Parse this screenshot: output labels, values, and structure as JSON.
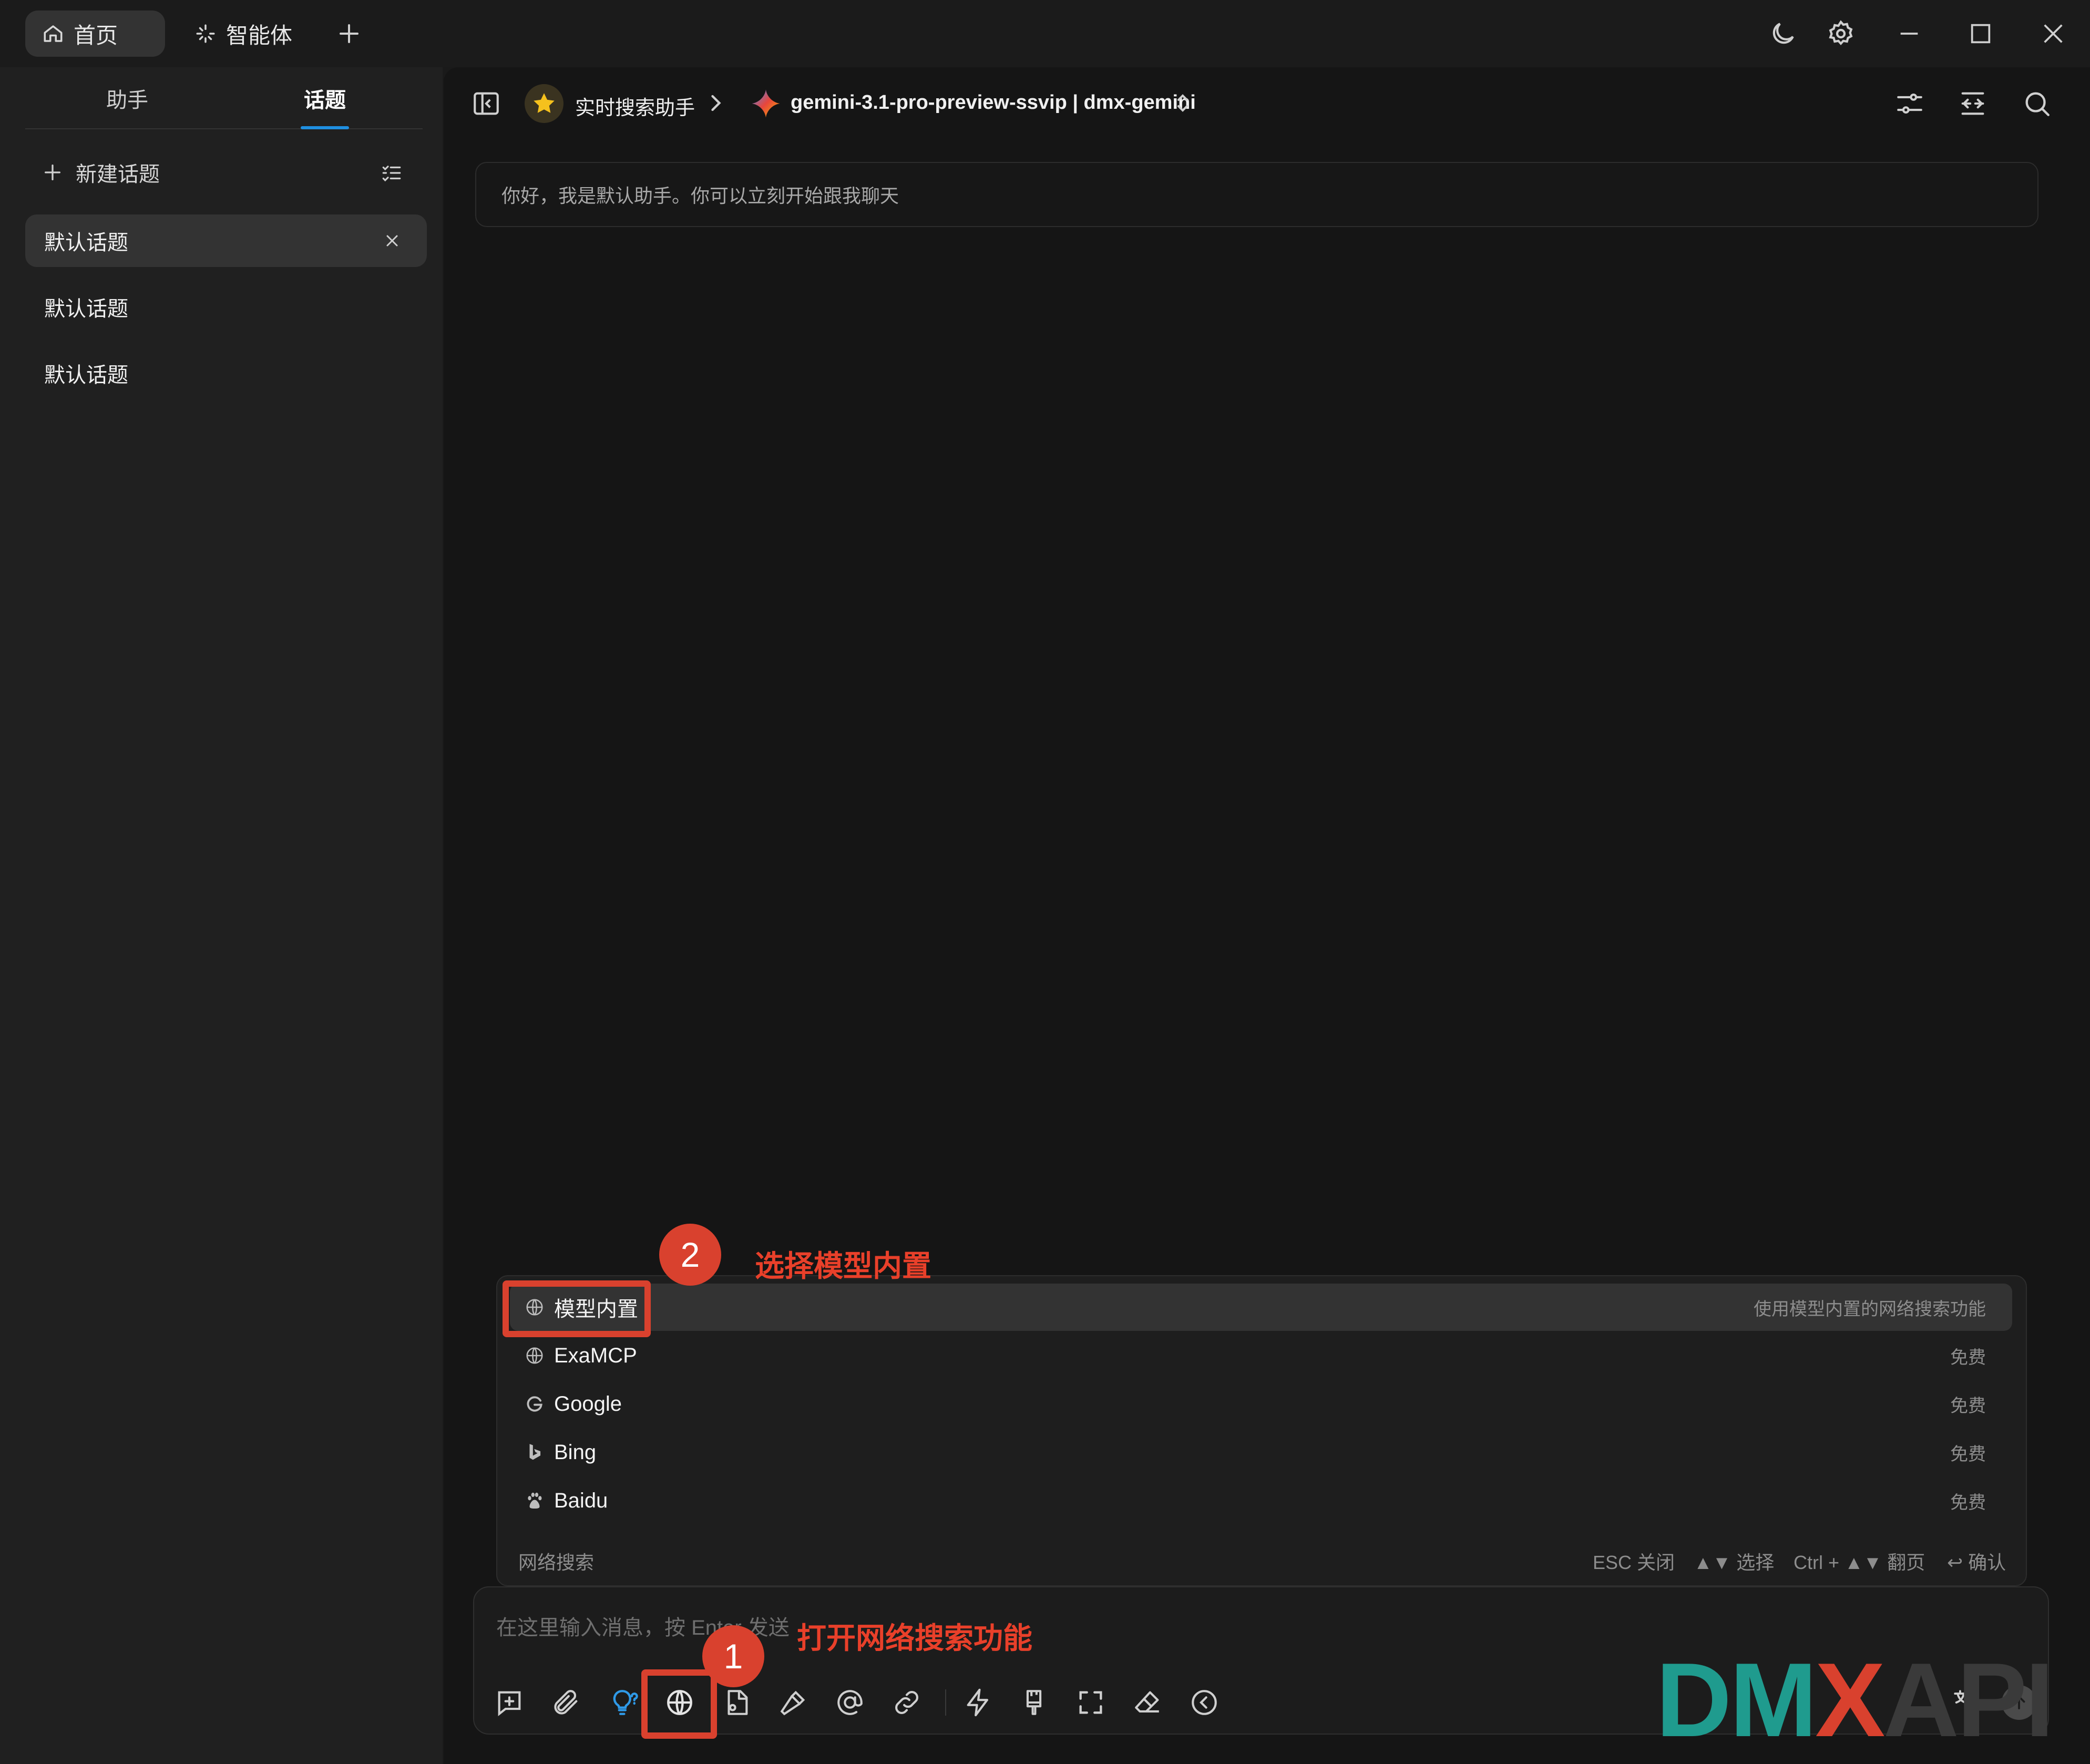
{
  "titlebar": {
    "tabs": [
      {
        "label": "首页",
        "icon": "home-icon"
      },
      {
        "label": "智能体",
        "icon": "sparkle-icon"
      }
    ],
    "add_tab_icon": "plus-icon",
    "controls": [
      "moon-icon",
      "gear-icon",
      "minimize-icon",
      "maximize-icon",
      "close-icon"
    ]
  },
  "sidebar": {
    "tabs": [
      "助手",
      "话题"
    ],
    "selected_tab": "话题",
    "new_topic_label": "新建话题",
    "topics": [
      "默认话题",
      "默认话题",
      "默认话题"
    ]
  },
  "header": {
    "assistant_name": "实时搜索助手",
    "model_name": "gemini-3.1-pro-preview-ssvip | dmx-gemini"
  },
  "chat": {
    "welcome_message": "你好，我是默认助手。你可以立刻开始跟我聊天"
  },
  "web_search_popup": {
    "items": [
      {
        "label": "模型内置",
        "desc": "使用模型内置的网络搜索功能",
        "icon": "globe-icon"
      },
      {
        "label": "ExaMCP",
        "desc": "免费",
        "icon": "globe-icon"
      },
      {
        "label": "Google",
        "desc": "免费",
        "icon": "google-icon"
      },
      {
        "label": "Bing",
        "desc": "免费",
        "icon": "bing-icon"
      },
      {
        "label": "Baidu",
        "desc": "免费",
        "icon": "baidu-icon"
      }
    ],
    "footer_title": "网络搜索",
    "hints": {
      "esc": "ESC 关闭",
      "select": "▲▼ 选择",
      "page": "Ctrl + ▲▼ 翻页",
      "confirm": "↩ 确认"
    }
  },
  "input": {
    "placeholder": "在这里输入消息，按 Enter 发送"
  },
  "annotations": {
    "step1_number": "1",
    "step1_text": "打开网络搜索功能",
    "step2_number": "2",
    "step2_text": "选择模型内置",
    "color": "#d9412e"
  },
  "watermark": {
    "text_dm": "DM",
    "text_x": "X",
    "text_api": "API",
    "colors": {
      "dm": "#1f9b8e",
      "x": "#d9412e",
      "api": "#3a3a3a"
    }
  }
}
